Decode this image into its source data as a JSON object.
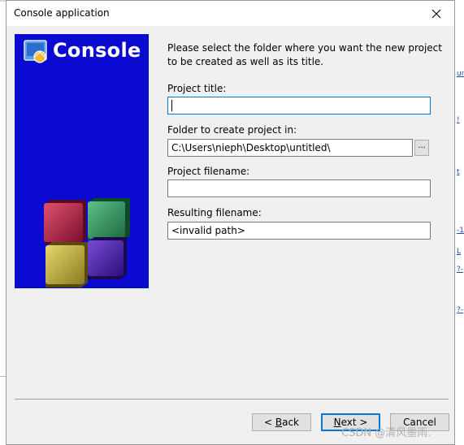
{
  "window": {
    "title": "Console application"
  },
  "banner": {
    "title": "Console"
  },
  "intro_text": "Please select the folder where you want the new project to be created as well as its title.",
  "fields": {
    "project_title": {
      "label": "Project title:",
      "value": ""
    },
    "folder": {
      "label": "Folder to create project in:",
      "value": "C:\\Users\\nieph\\Desktop\\untitled\\"
    },
    "project_filename": {
      "label": "Project filename:",
      "value": ""
    },
    "resulting_filename": {
      "label": "Resulting filename:",
      "value": "<invalid path>"
    }
  },
  "browse_label": "...",
  "buttons": {
    "back": {
      "prefix": "< ",
      "mnemonic": "B",
      "rest": "ack"
    },
    "next": {
      "mnemonic": "N",
      "rest": "ext >"
    },
    "cancel": {
      "label": "Cancel"
    }
  },
  "background_links": [
    "ur",
    "!",
    "t",
    "-1",
    "L",
    "?-",
    "?-"
  ],
  "watermark": "CSDN @清风墨雨."
}
